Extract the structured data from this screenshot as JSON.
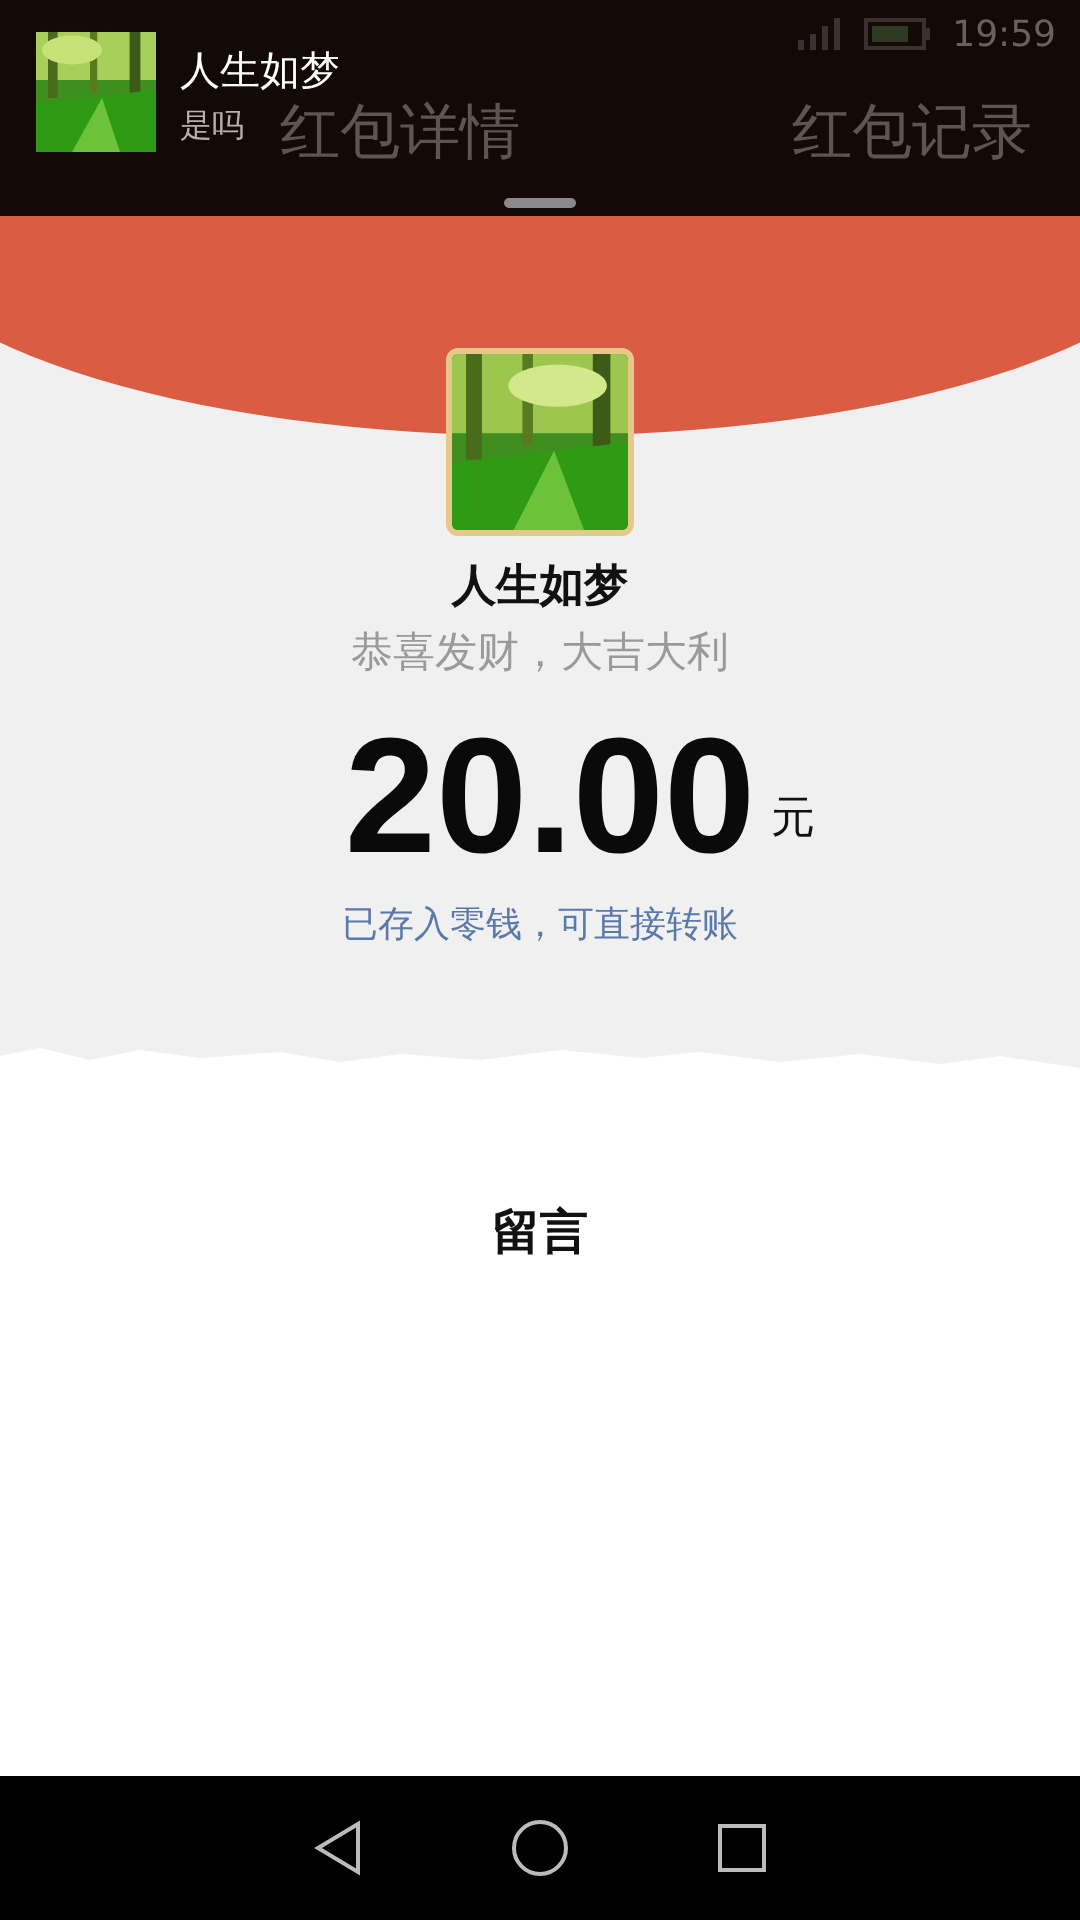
{
  "status_bar": {
    "time": "19:59"
  },
  "header": {
    "title": "红包详情",
    "records_link": "红包记录"
  },
  "notification": {
    "title": "人生如梦",
    "message": "是吗"
  },
  "sender": {
    "name": "人生如梦",
    "greeting": "恭喜发财，大吉大利"
  },
  "amount": {
    "value": "20.00",
    "unit": "元",
    "note": "已存入零钱，可直接转账"
  },
  "message_section": {
    "title": "留言"
  }
}
